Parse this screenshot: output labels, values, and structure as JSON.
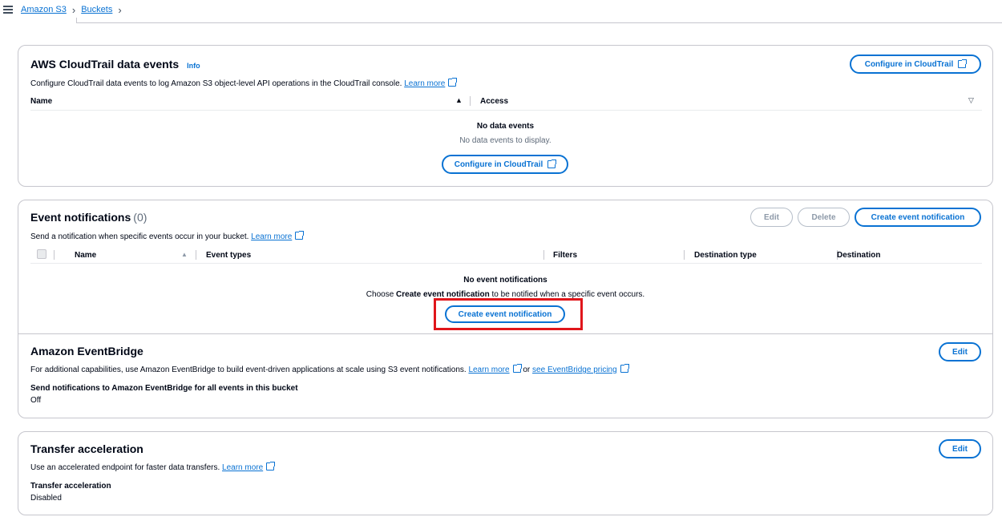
{
  "breadcrumbs": [
    "Amazon S3",
    "Buckets"
  ],
  "cloudtrail": {
    "title": "AWS CloudTrail data events",
    "info": "Info",
    "description": "Configure CloudTrail data events to log Amazon S3 object-level API operations in the CloudTrail console.",
    "learn_more": "Learn more",
    "configure_button": "Configure in CloudTrail",
    "columns": [
      "Name",
      "Access"
    ],
    "empty_title": "No data events",
    "empty_sub": "No data events to display.",
    "empty_button": "Configure in CloudTrail"
  },
  "events": {
    "title": "Event notifications",
    "count": "(0)",
    "description": "Send a notification when specific events occur in your bucket.",
    "learn_more": "Learn more",
    "edit_button": "Edit",
    "delete_button": "Delete",
    "create_button": "Create event notification",
    "columns": [
      "Name",
      "Event types",
      "Filters",
      "Destination type",
      "Destination"
    ],
    "empty_title": "No event notifications",
    "empty_pre": "Choose",
    "empty_bold": "Create event notification",
    "empty_post": "to be notified when a specific event occurs.",
    "empty_button": "Create event notification"
  },
  "eventbridge": {
    "title": "Amazon EventBridge",
    "edit_button": "Edit",
    "description": "For additional capabilities, use Amazon EventBridge to build event-driven applications at scale using S3 event notifications.",
    "learn_more": "Learn more",
    "or": "or",
    "pricing_link": "see EventBridge pricing",
    "field_label": "Send notifications to Amazon EventBridge for all events in this bucket",
    "field_value": "Off"
  },
  "transfer": {
    "title": "Transfer acceleration",
    "edit_button": "Edit",
    "description": "Use an accelerated endpoint for faster data transfers.",
    "learn_more": "Learn more",
    "field_label": "Transfer acceleration",
    "field_value": "Disabled"
  },
  "colors": {
    "link": "#0972d3",
    "border": "#c6c6cd",
    "highlight": "#e0161b"
  },
  "icons": [
    "hamburger-icon",
    "chevron-right-icon",
    "external-link-icon",
    "sort-ascending-icon",
    "sort-descending-icon",
    "checkbox"
  ]
}
